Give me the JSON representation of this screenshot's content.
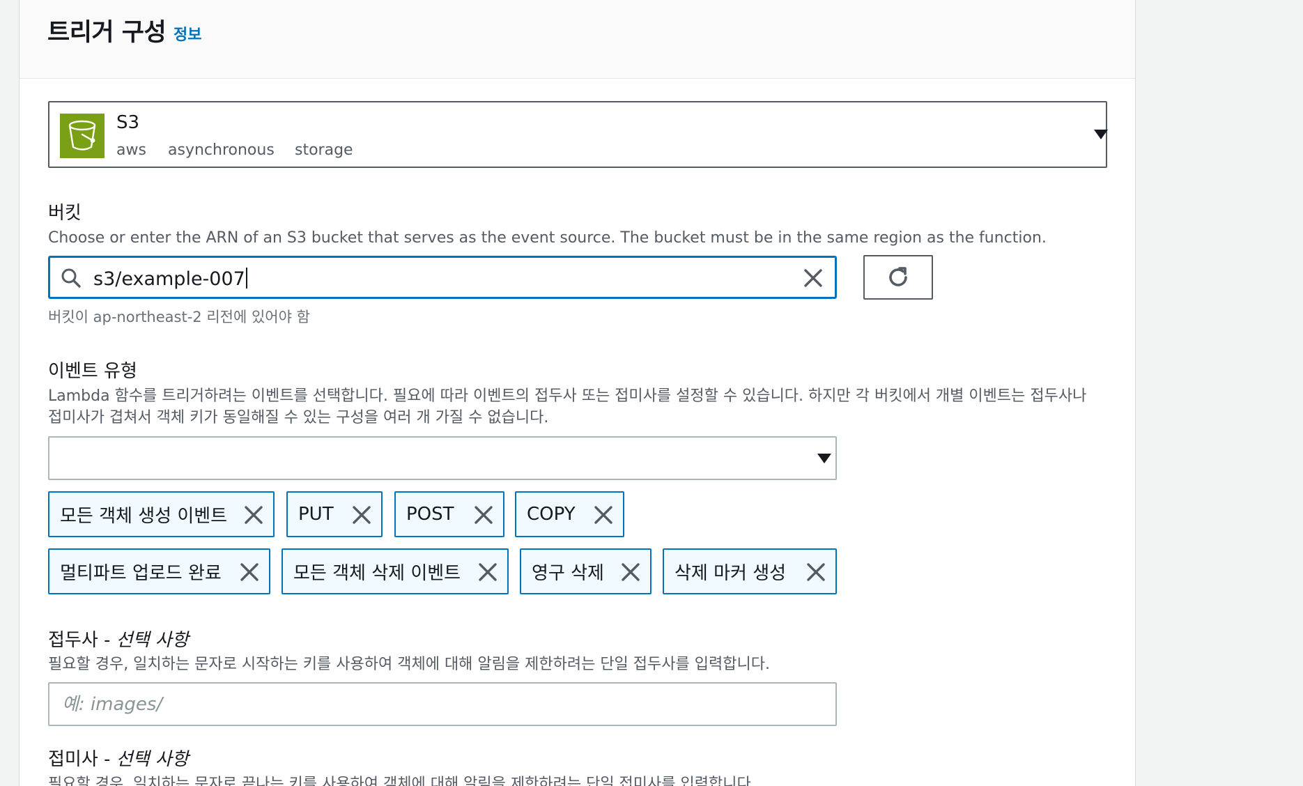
{
  "panel": {
    "title": "트리거 구성",
    "info_link": "정보"
  },
  "service": {
    "name": "S3",
    "tags": [
      "aws",
      "asynchronous",
      "storage"
    ],
    "icon": "s3-bucket-icon",
    "icon_bg": "#7aa116"
  },
  "bucket": {
    "label": "버킷",
    "description": "Choose or enter the ARN of an S3 bucket that serves as the event source. The bucket must be in the same region as the function.",
    "value": "s3/example-007",
    "hint": "버킷이 ap-northeast-2 리전에 있어야 함"
  },
  "event_type": {
    "label": "이벤트 유형",
    "description_line1": "Lambda 함수를 트리거하려는 이벤트를 선택합니다. 필요에 따라 이벤트의 접두사 또는 접미사를 설정할 수 있습니다. 하지만 각 버킷에서 개별 이벤트는 접두사나",
    "description_line2": "접미사가 겹쳐서 객체 키가 동일해질 수 있는 구성을 여러 개 가질 수 없습니다.",
    "selected_tokens": [
      "모든 객체 생성 이벤트",
      "PUT",
      "POST",
      "COPY",
      "멀티파트 업로드 완료",
      "모든 객체 삭제 이벤트",
      "영구 삭제",
      "삭제 마커 생성"
    ]
  },
  "prefix": {
    "label": "접두사 - ",
    "label_optional": "선택 사항",
    "description": "필요할 경우, 일치하는 문자로 시작하는 키를 사용하여 객체에 대해 알림을 제한하려는 단일 접두사를 입력합니다.",
    "placeholder": "예: images/"
  },
  "suffix": {
    "label": "접미사 - ",
    "label_optional": "선택 사항",
    "description": "필요할 경우, 일치하는 문자로 끝나는 키를 사용하여 객체에 대해 알림을 제한하려는 단일 접미사를 입력합니다."
  },
  "colors": {
    "accent": "#0073bb",
    "token_bg": "#f1faff",
    "border": "#545b64"
  }
}
